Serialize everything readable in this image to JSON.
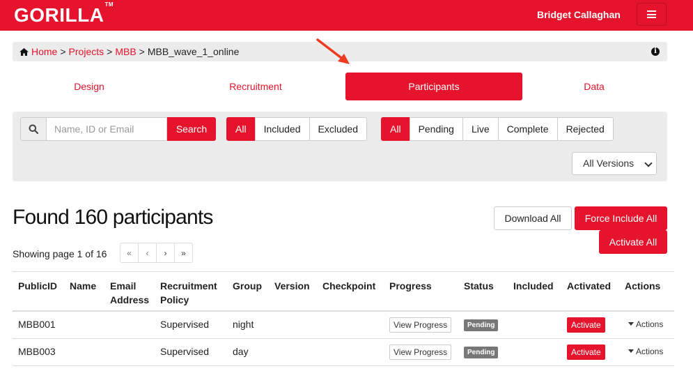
{
  "colors": {
    "brand": "#e5132c",
    "pending": "#777777"
  },
  "header": {
    "logo": "GORILLA",
    "logo_tm": "TM",
    "user_name": "Bridget Callaghan",
    "menu_icon": "hamburger-icon"
  },
  "breadcrumb": {
    "home": "Home",
    "projects": "Projects",
    "mbb": "MBB",
    "current": "MBB_wave_1_online",
    "sep": ">"
  },
  "tabs": [
    "Design",
    "Recruitment",
    "Participants",
    "Data"
  ],
  "filters": {
    "search_placeholder": "Name, ID or Email",
    "search_button": "Search",
    "inclusion": [
      "All",
      "Included",
      "Excluded"
    ],
    "status": [
      "All",
      "Pending",
      "Live",
      "Complete",
      "Rejected"
    ],
    "version_select": "All Versions"
  },
  "summary": {
    "found": "Found 160 participants",
    "showing": "Showing page 1 of 16",
    "download_all": "Download All",
    "force_include_all": "Force Include All",
    "activate_all": "Activate All"
  },
  "pager": [
    "«",
    "‹",
    "›",
    "»"
  ],
  "table": {
    "headers": {
      "public_id": "PublicID",
      "name": "Name",
      "email_1": "Email",
      "email_2": "Address",
      "policy_1": "Recruitment",
      "policy_2": "Policy",
      "group": "Group",
      "version": "Version",
      "checkpoint": "Checkpoint",
      "progress": "Progress",
      "status": "Status",
      "included": "Included",
      "activated": "Activated",
      "actions": "Actions"
    },
    "rows": [
      {
        "id": "MBB001",
        "policy": "Supervised",
        "group": "night",
        "progress": "View Progress",
        "status": "Pending",
        "activate": "Activate",
        "actions": "Actions"
      },
      {
        "id": "MBB003",
        "policy": "Supervised",
        "group": "day",
        "progress": "View Progress",
        "status": "Pending",
        "activate": "Activate",
        "actions": "Actions"
      }
    ]
  }
}
